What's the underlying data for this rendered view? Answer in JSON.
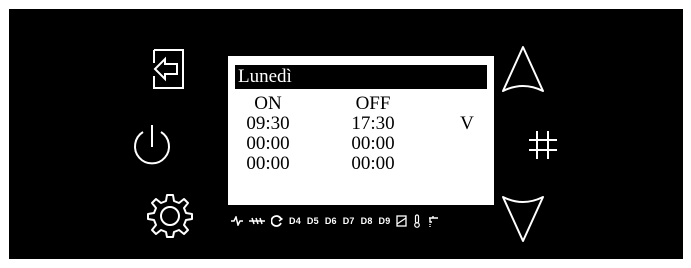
{
  "display": {
    "title": "Lunedì",
    "headers": {
      "on": "ON",
      "off": "OFF"
    },
    "rows": [
      {
        "on": "09:30",
        "off": "17:30",
        "flag": "V"
      },
      {
        "on": "00:00",
        "off": "00:00",
        "flag": ""
      },
      {
        "on": "00:00",
        "off": "00:00",
        "flag": ""
      }
    ]
  },
  "status_bar": {
    "digital_labels": [
      "D4",
      "D5",
      "D6",
      "D7",
      "D8",
      "D9"
    ]
  },
  "buttons": {
    "left": [
      "exit-icon",
      "power-icon",
      "gear-icon"
    ],
    "right": [
      "arrow-up-icon",
      "hash-icon",
      "arrow-down-icon"
    ]
  },
  "colors": {
    "panel": "#000000",
    "screen": "#ffffff",
    "foreground": "#ffffff"
  }
}
